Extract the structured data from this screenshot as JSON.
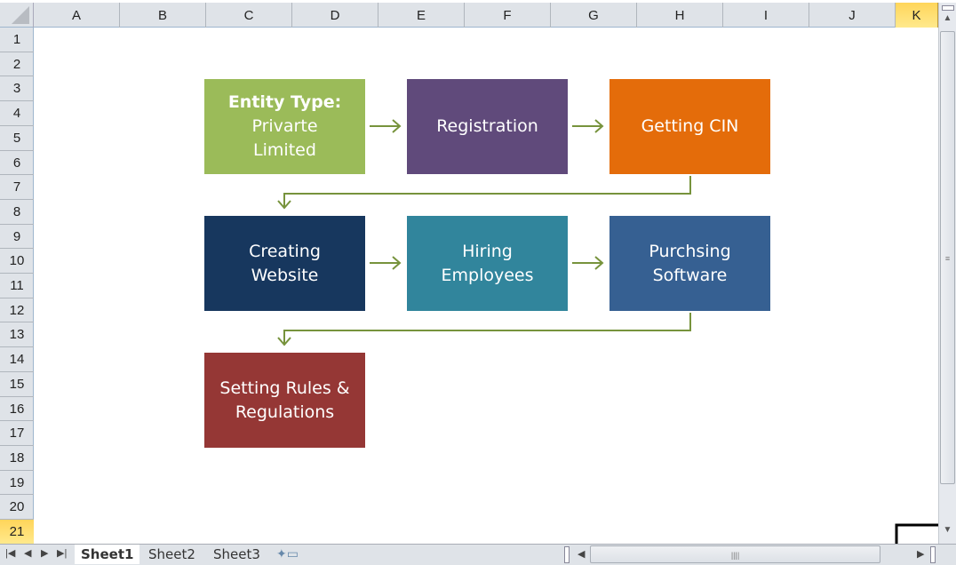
{
  "columns": [
    "A",
    "B",
    "C",
    "D",
    "E",
    "F",
    "G",
    "H",
    "I",
    "J",
    "K"
  ],
  "rows": [
    "1",
    "2",
    "3",
    "4",
    "5",
    "6",
    "7",
    "8",
    "9",
    "10",
    "11",
    "12",
    "13",
    "14",
    "15",
    "16",
    "17",
    "18",
    "19",
    "20",
    "21"
  ],
  "selected_cell": "K21",
  "flowchart": {
    "connector_color": "#77933C",
    "boxes": [
      {
        "title": "Entity Type:",
        "text": "Privarte Limited",
        "color": "#9BBB59"
      },
      {
        "text": "Registration",
        "color": "#604A7B"
      },
      {
        "text": "Getting CIN",
        "color": "#E46C0A"
      },
      {
        "text": "Creating Website",
        "color": "#17375E"
      },
      {
        "text": "Hiring Employees",
        "color": "#31859C"
      },
      {
        "text": "Purchsing Software",
        "color": "#366092"
      },
      {
        "text": "Setting Rules & Regulations",
        "color": "#953735"
      }
    ]
  },
  "sheets": [
    "Sheet1",
    "Sheet2",
    "Sheet3"
  ],
  "active_sheet": "Sheet1"
}
